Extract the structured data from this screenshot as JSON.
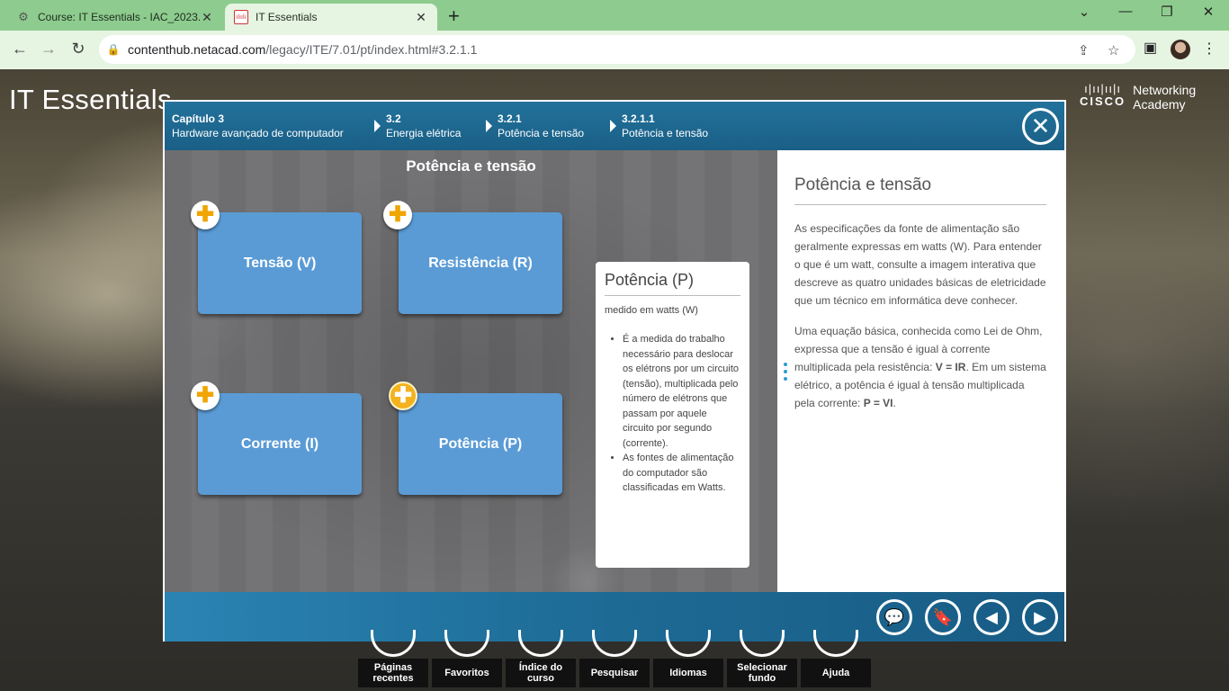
{
  "browser": {
    "tabs": [
      {
        "title": "Course: IT Essentials - IAC_2023.2",
        "active": false
      },
      {
        "title": "IT Essentials",
        "active": true,
        "favicon": "cisco"
      }
    ],
    "url_host": "contenthub.netacad.com",
    "url_path": "/legacy/ITE/7.01/pt/index.html#3.2.1.1"
  },
  "page": {
    "brand": "IT Essentials",
    "cisco_word": "CISCO",
    "networking": "Networking",
    "academy": "Academy"
  },
  "breadcrumbs": [
    {
      "num": "Capítulo 3",
      "label": "Hardware avançado de computador"
    },
    {
      "num": "3.2",
      "label": "Energia elétrica"
    },
    {
      "num": "3.2.1",
      "label": "Potência e tensão"
    },
    {
      "num": "3.2.1.1",
      "label": "Potência e tensão"
    }
  ],
  "stage": {
    "title": "Potência e tensão",
    "cards": [
      "Tensão (V)",
      "Resistência (R)",
      "Corrente (I)",
      "Potência (P)"
    ],
    "active_card": "Potência (P)"
  },
  "info": {
    "title": "Potência (P)",
    "subtitle": "medido em watts (W)",
    "bullets": [
      "É a medida do trabalho necessário para deslocar os elétrons por um circuito (tensão), multiplicada pelo número de elétrons que passam por aquele circuito por segundo (corrente).",
      "As fontes de alimentação do computador são classificadas em Watts."
    ]
  },
  "text_panel": {
    "title": "Potência e tensão",
    "p1": "As especificações da fonte de alimentação são geralmente expressas em watts (W). Para entender o que é um watt, consulte a imagem interativa que descreve as quatro unidades básicas de eletricidade que um técnico em informática deve conhecer.",
    "p2_a": "Uma equação básica, conhecida como Lei de Ohm, expressa que a tensão é igual à corrente multiplicada pela resistência: ",
    "p2_b": "V = IR",
    "p2_c": ". Em um sistema elétrico, a potência é igual à tensão multiplicada pela corrente: ",
    "p2_d": "P = VI",
    "p2_e": "."
  },
  "bottom_menu": [
    "Páginas recentes",
    "Favoritos",
    "Índice do curso",
    "Pesquisar",
    "Idiomas",
    "Selecionar fundo",
    "Ajuda"
  ],
  "colors": {
    "card": "#5a9bd5",
    "accent": "#f3b21e",
    "header": "#1a5f86"
  }
}
